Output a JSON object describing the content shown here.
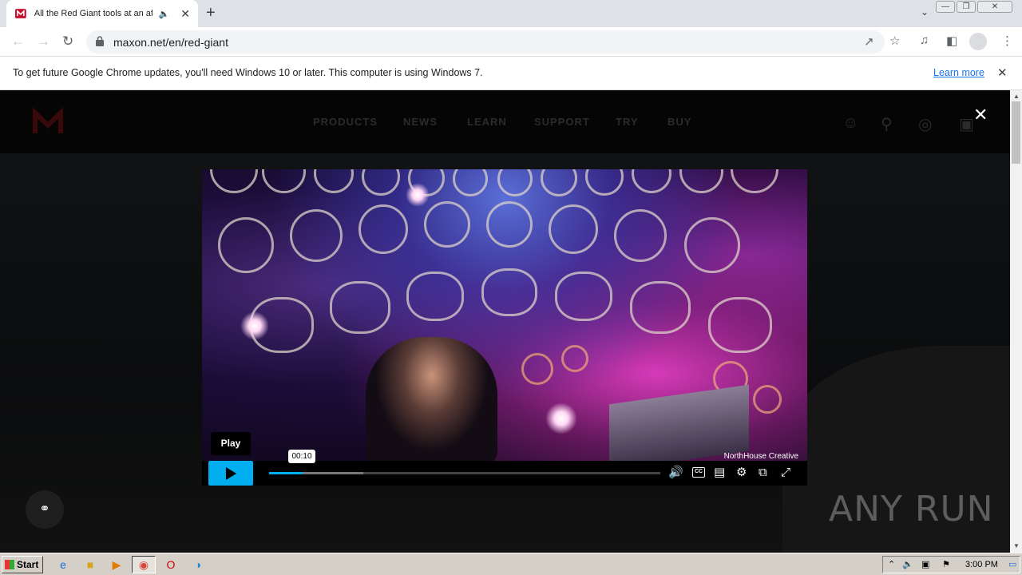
{
  "browser": {
    "tab_title": "All the Red Giant tools at an aff",
    "url": "maxon.net/en/red-giant",
    "infobar_text": "To get future Google Chrome updates, you'll need Windows 10 or later. This computer is using Windows 7.",
    "infobar_link": "Learn more"
  },
  "site": {
    "nav": [
      "PRODUCTS",
      "NEWS",
      "LEARN",
      "SUPPORT",
      "TRY",
      "BUY"
    ]
  },
  "video": {
    "watermark": "NorthHouse Creative",
    "play_tooltip": "Play",
    "time_tooltip": "00:10",
    "progress_played": 0.085,
    "progress_buffered": 0.24
  },
  "overlay": {
    "anyrun_logo": "ANY RUN"
  },
  "taskbar": {
    "start_label": "Start",
    "clock": "3:00 PM"
  },
  "colors": {
    "accent": "#00adef",
    "link": "#1a73e8"
  }
}
